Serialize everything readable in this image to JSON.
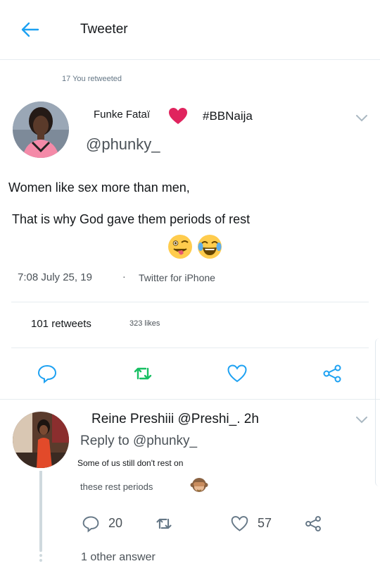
{
  "header": {
    "title": "Tweeter"
  },
  "tweet": {
    "retweet_notice": "17 You retweeted",
    "author_name": "Funke Fataï",
    "hashtag": "#BBNaija",
    "handle": "@phunky_",
    "text_line1": "Women like sex more than men,",
    "text_line2": "That is why God gave them periods of rest",
    "emojis": [
      "winking-face-with-tongue",
      "face-with-tears-of-joy"
    ],
    "time": "7:08 July 25, 19",
    "separator": "·",
    "client": "Twitter for iPhone",
    "retweets": "101 retweets",
    "likes": "323 likes"
  },
  "reply": {
    "author": "Reine Preshiii @Preshi_. 2h",
    "reply_to": "Reply to @phunky_",
    "text_line1": "Some of us still don't rest on",
    "text_line2": "these rest periods",
    "emoji": "see-no-evil-monkey",
    "reply_count": "20",
    "like_count": "57",
    "other_answers": "1 other answer"
  },
  "colors": {
    "accent": "#1da1f2",
    "retweet_green": "#17bf63",
    "heart_red": "#e0245e",
    "muted": "#657786"
  }
}
